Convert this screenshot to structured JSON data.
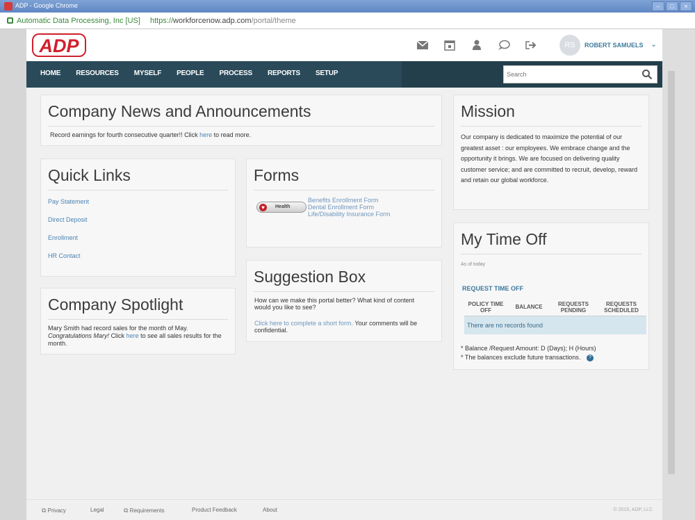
{
  "window": {
    "title": "ADP - Google Chrome",
    "controls": [
      "–",
      "□",
      "×"
    ]
  },
  "addressbar": {
    "secure_label": "Automatic Data Processing, Inc [US]",
    "url_protocol": "https://",
    "url_host": "workforcenow.adp.com",
    "url_path": "/portal/theme"
  },
  "header": {
    "logo_text": "ADP",
    "avatar_initials": "RS",
    "username": "ROBERT SAMUELS",
    "icons": [
      "mail-icon",
      "calendar-icon",
      "person-icon",
      "chat-icon",
      "logout-icon"
    ]
  },
  "nav": {
    "items": [
      "HOME",
      "RESOURCES",
      "MYSELF",
      "PEOPLE",
      "PROCESS",
      "REPORTS",
      "SETUP"
    ],
    "search_placeholder": "Search"
  },
  "news": {
    "title": "Company News and Announcements",
    "text_before": "Record earnings for fourth consecutive quarter!! Click",
    "link": "here",
    "text_after": "to read more."
  },
  "quick_links": {
    "title": "Quick Links",
    "items": [
      "Pay Statement",
      "Direct Deposit",
      "Enrollment",
      "HR Contact"
    ]
  },
  "forms": {
    "title": "Forms",
    "button_label": "Health",
    "links": [
      "Benefits Enrollment Form",
      "Dental Enrollment Form",
      "Life/Disability Insurance Form"
    ]
  },
  "mission": {
    "title": "Mission",
    "text": "Our company is dedicated to maximize the potential of our greatest asset : our employees. We embrace change and the opportunity it brings. We are focused on delivering quality customer service; and are committed to recruit, develop, reward and retain our global workforce."
  },
  "spotlight": {
    "title": "Company Spotlight",
    "text_before": "Mary Smith had record sales for the month of May.",
    "italic": "Congratulations Mary!",
    "text_mid": "Click",
    "link": "here",
    "text_after": "to see all sales results for the month."
  },
  "suggestion": {
    "title": "Suggestion Box",
    "question": "How can we make this portal better? What kind of content would you like to see?",
    "link": "Click here to complete a short form.",
    "after_link": "Your comments will be confidential."
  },
  "timeoff": {
    "title": "My Time Off",
    "as_of": "As of today",
    "request_link": "REQUEST TIME OFF",
    "columns": [
      "POLICY TIME OFF",
      "BALANCE",
      "REQUESTS PENDING",
      "REQUESTS SCHEDULED"
    ],
    "empty_message": "There are no records found",
    "note1": "* Balance /Request Amount: D (Days); H (Hours)",
    "note2": "* The balances exclude future transactions."
  },
  "footer": {
    "links": [
      "Privacy",
      "Legal",
      "Requirements",
      "Product Feedback",
      "About"
    ],
    "copyright": "© 2015, ADP, LLC"
  },
  "colors": {
    "nav_bg": "#2a4a5a",
    "brand_red": "#d0202c",
    "link_blue": "#4a84b5"
  }
}
